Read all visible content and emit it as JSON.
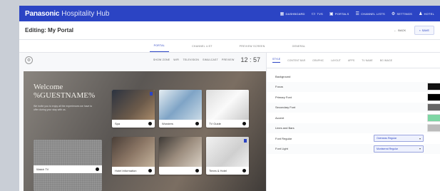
{
  "app": {
    "brand": "Panasonic",
    "title": "Hospitality Hub"
  },
  "topnav": [
    {
      "label": "DASHBOARD",
      "icon": "grid-icon"
    },
    {
      "label": "TVS",
      "icon": "tv-icon"
    },
    {
      "label": "PORTALS",
      "icon": "portal-icon"
    },
    {
      "label": "CHANNEL LISTS",
      "icon": "list-icon"
    },
    {
      "label": "SETTINGS",
      "icon": "gear-icon"
    },
    {
      "label": "HOTEL",
      "icon": "user-icon"
    }
  ],
  "page": {
    "title": "Editing: My Portal",
    "back_label": "BACK",
    "save_label": "SAVE"
  },
  "tabs": [
    "PORTAL",
    "CHANNEL LIST",
    "PREVIEW SCREEN",
    "GENERAL"
  ],
  "preview_toolbar": {
    "items": [
      "SHOW ZONE",
      "WIFI",
      "TELEVISION",
      "SIMULCAST",
      "PREVIEW"
    ],
    "time": "12 : 57"
  },
  "preview": {
    "welcome_line1": "Welcome",
    "welcome_line2": "%GUESTNAME%",
    "welcome_sub": "We invite you to enjoy all the experiences we have to offer during your stay with us.",
    "tiles": [
      {
        "label": "Spa"
      },
      {
        "label": "Wonders"
      },
      {
        "label": "TV Guide"
      },
      {
        "label": "Watch TV"
      },
      {
        "label": "Hotel Information"
      },
      {
        "label": "Times & Hotel"
      }
    ]
  },
  "settings": {
    "subtabs": [
      "STYLE",
      "CONTENT BAR",
      "GRAPHIC",
      "LAYOUT",
      "APPS",
      "TV NAME",
      "BG IMAGE"
    ],
    "rows": [
      {
        "label": "Background",
        "swatch": ""
      },
      {
        "label": "Focus",
        "swatch": "#111111"
      },
      {
        "label": "Primary Font",
        "swatch": "#000000"
      },
      {
        "label": "Secondary Font",
        "swatch": "#666666"
      },
      {
        "label": "Accent",
        "swatch": "#7ed6a4"
      },
      {
        "label": "Lines and Bars",
        "swatch": "#bbbbbb"
      }
    ],
    "font_rows": [
      {
        "label": "Font Regular",
        "value": "Overseas Regular"
      },
      {
        "label": "Font Light",
        "value": "Montserrat Regular"
      }
    ]
  }
}
